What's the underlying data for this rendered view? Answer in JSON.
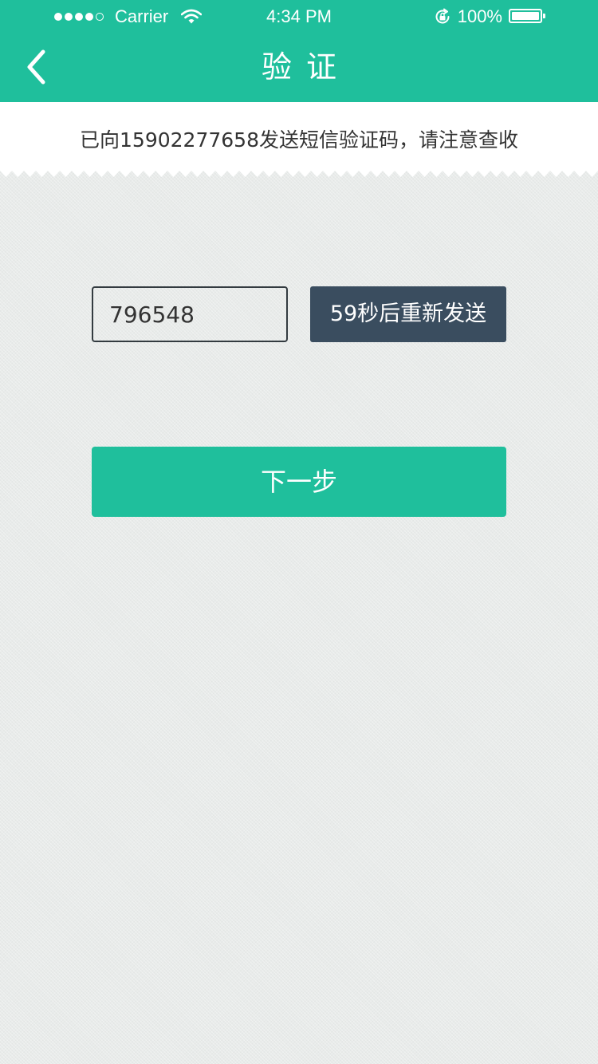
{
  "status_bar": {
    "carrier": "Carrier",
    "time": "4:34 PM",
    "battery_percent": "100%",
    "signal_strength": 4,
    "signal_max": 5,
    "battery_level": 1.0,
    "icons": [
      "signal-dots-icon",
      "wifi-icon",
      "rotation-lock-icon",
      "battery-icon"
    ]
  },
  "nav": {
    "title": "验证",
    "back_icon": "chevron-left-icon"
  },
  "notice": {
    "text": "已向15902277658发送短信验证码，请注意查收"
  },
  "verification": {
    "code_value": "796548",
    "resend_label": "59秒后重新发送"
  },
  "actions": {
    "next_label": "下一步"
  },
  "colors": {
    "primary": "#1fbf9c",
    "resend_button": "#3a4d5f",
    "background": "#e8ebea",
    "text_dark": "#333333"
  }
}
